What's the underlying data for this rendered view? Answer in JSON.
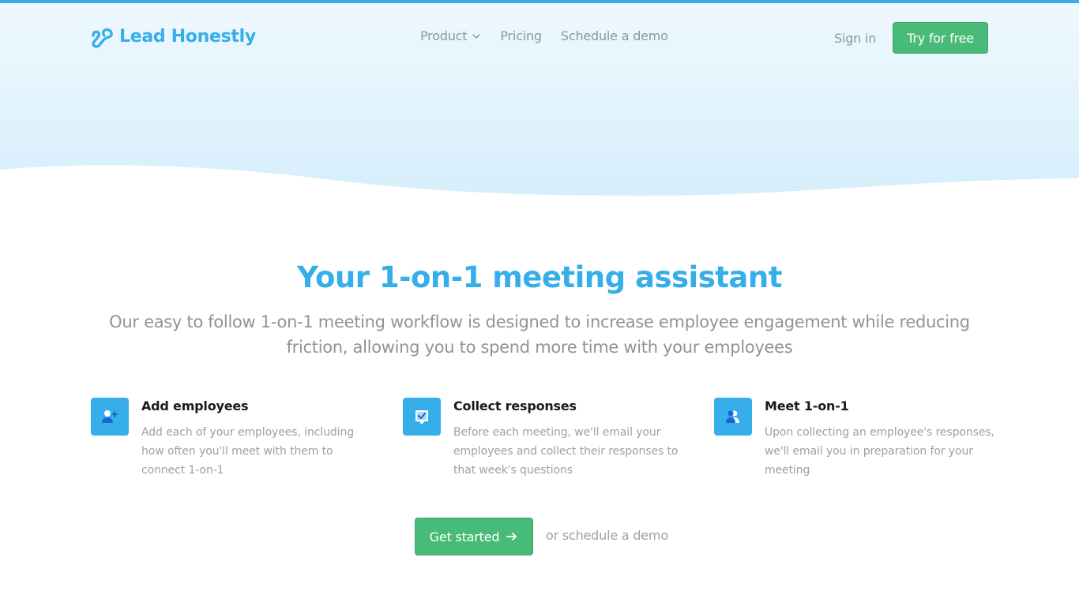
{
  "colors": {
    "brand": "#35aeea",
    "cta_green": "#48bb78",
    "muted_text": "#8c959d",
    "icon_dark_blue": "#1e63d6"
  },
  "header": {
    "logo_icon": "lead-honestly-logo-icon",
    "logo_text": "Lead Honestly",
    "nav": [
      {
        "label": "Product",
        "icon": "chevron-down-icon"
      },
      {
        "label": "Pricing"
      },
      {
        "label": "Schedule a demo"
      }
    ],
    "sign_in": "Sign in",
    "try_free": "Try for free"
  },
  "hero": {
    "headline": "Your 1-on-1 meeting assistant",
    "subtitle": "Our easy to follow 1-on-1 meeting workflow is designed to increase employee engagement while reducing friction, allowing you to spend more time with your employees"
  },
  "features": [
    {
      "icon": "add-user-icon",
      "title": "Add employees",
      "description": "Add each of your employees, including how often you'll meet with them to connect 1-on-1"
    },
    {
      "icon": "inbox-check-icon",
      "title": "Collect responses",
      "description": "Before each meeting, we'll email your employees and collect their responses to that week's questions"
    },
    {
      "icon": "users-icon",
      "title": "Meet 1-on-1",
      "description": "Upon collecting an employee's responses, we'll email you in preparation for your meeting"
    }
  ],
  "cta": {
    "primary": "Get started",
    "primary_icon": "arrow-right-icon",
    "secondary": "or schedule a demo"
  }
}
